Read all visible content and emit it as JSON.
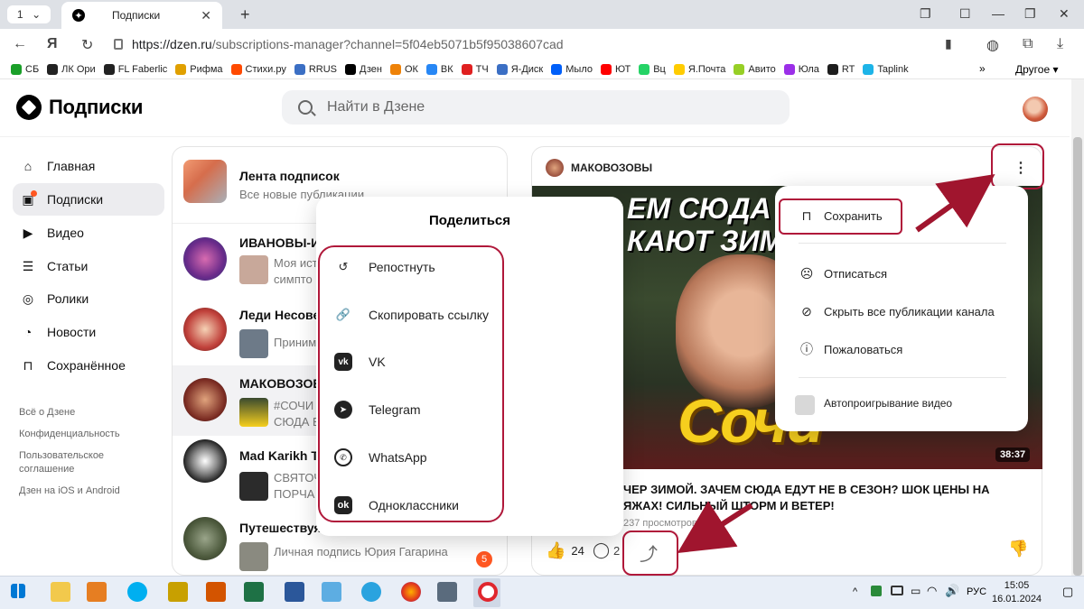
{
  "browser": {
    "tab_count": "1",
    "tab_title": "Подписки",
    "url_host": "https://dzen.ru",
    "url_path": "/subscriptions-manager?channel=5f04eb5071b5f95038607cad",
    "bookmarks": [
      {
        "label": "СБ",
        "color": "#1a9f29"
      },
      {
        "label": "ЛК Ори",
        "color": "#222222"
      },
      {
        "label": "FL Faberlic",
        "color": "#222222"
      },
      {
        "label": "Рифма",
        "color": "#e0a000"
      },
      {
        "label": "Стихи.ру",
        "color": "#ff4a00"
      },
      {
        "label": "RRUS",
        "color": "#3b6fc4"
      },
      {
        "label": "Дзен",
        "color": "#000000"
      },
      {
        "label": "ОК",
        "color": "#ee8208"
      },
      {
        "label": "ВК",
        "color": "#2787f5"
      },
      {
        "label": "ТЧ",
        "color": "#e02020"
      },
      {
        "label": "Я-Диск",
        "color": "#3b6fc4"
      },
      {
        "label": "Мыло",
        "color": "#005ff9"
      },
      {
        "label": "ЮТ",
        "color": "#ff0000"
      },
      {
        "label": "Вц",
        "color": "#25d366"
      },
      {
        "label": "Я.Почта",
        "color": "#ffcc00"
      },
      {
        "label": "Авито",
        "color": "#97cf26"
      },
      {
        "label": "Юла",
        "color": "#9b2fe8"
      },
      {
        "label": "RT",
        "color": "#1d1d1d"
      },
      {
        "label": "Taplink",
        "color": "#1db4e8"
      }
    ],
    "bookmarks_more": "»",
    "bookmarks_other": "Другое ▾"
  },
  "header": {
    "logo": "Подписки",
    "search_placeholder": "Найти в Дзене"
  },
  "sidebar": {
    "items": [
      {
        "label": "Главная",
        "icon": "home-icon",
        "glyph": "⌂"
      },
      {
        "label": "Подписки",
        "icon": "subscriptions-icon",
        "glyph": "▣"
      },
      {
        "label": "Видео",
        "icon": "video-icon",
        "glyph": "▶"
      },
      {
        "label": "Статьи",
        "icon": "articles-icon",
        "glyph": "☰"
      },
      {
        "label": "Ролики",
        "icon": "shorts-icon",
        "glyph": "◎"
      },
      {
        "label": "Новости",
        "icon": "news-icon",
        "glyph": "◔"
      },
      {
        "label": "Сохранённое",
        "icon": "bookmark-icon",
        "glyph": "⊓"
      }
    ],
    "footer": [
      "Всё о Дзене",
      "Конфиденциальность",
      "Пользовательское соглашение",
      "Дзен на iOS и Android"
    ]
  },
  "subscriptions": [
    {
      "name": "Лента подписок",
      "desc": "Все новые публикации"
    },
    {
      "name": "ИВАНОВЫ-И",
      "desc": "Моя ист\nсимпто"
    },
    {
      "name": "Леди Несове",
      "desc": "Приним"
    },
    {
      "name": "МАКОВОЗОВЫ",
      "desc": "#СОЧИ\nСЮДА Е"
    },
    {
      "name": "Mad Karikh TA",
      "desc": "СВЯТОЧ\nПОРЧА"
    },
    {
      "name": "Путешествуя",
      "desc": "Личная подпись Юрия Гагарина"
    }
  ],
  "unread_badge": "5",
  "share_popup": {
    "title": "Поделиться",
    "items": [
      {
        "label": "Репостнуть",
        "icon": "repost-icon"
      },
      {
        "label": "Скопировать ссылку",
        "icon": "link-icon"
      },
      {
        "label": "VK",
        "icon": "vk-icon"
      },
      {
        "label": "Telegram",
        "icon": "telegram-icon"
      },
      {
        "label": "WhatsApp",
        "icon": "whatsapp-icon"
      },
      {
        "label": "Одноклассники",
        "icon": "odnoklassniki-icon"
      }
    ]
  },
  "post": {
    "channel": "МАКОВОЗОВЫ",
    "video_headline": "ЕМ СЮДА\nКАЮТ ЗИМОЙ",
    "video_big": "Сочи",
    "duration": "38:37",
    "title": "ЧЕР ЗИМОЙ. ЗАЧЕМ СЮДА ЕДУТ НЕ В СЕЗОН? ШОК ЦЕНЫ НА\nЯЖАХ! СИЛЬНЫЙ ШТОРМ И ВЕТЕР!",
    "views": "237 просмотров",
    "likes": "24",
    "comments": "2"
  },
  "menu": {
    "save": "Сохранить",
    "unsubscribe": "Отписаться",
    "hide": "Скрыть все публикации канала",
    "report": "Пожаловаться",
    "autoplay": "Автопроигрывание видео"
  },
  "taskbar": {
    "lang": "РУС",
    "time": "15:05",
    "date": "16.01.2024"
  },
  "colors": {
    "highlight": "#b0183a",
    "arrow": "#a0152e",
    "accent": "#ff6a2b"
  }
}
